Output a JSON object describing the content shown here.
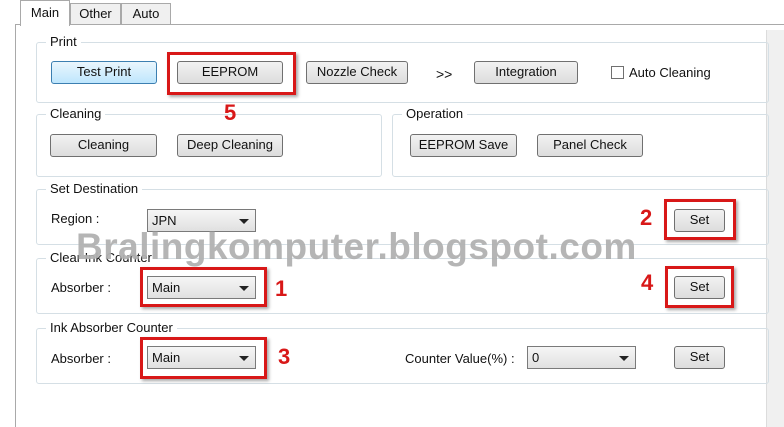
{
  "tabs": [
    {
      "label": "Main",
      "active": true
    },
    {
      "label": "Other",
      "active": false
    },
    {
      "label": "Auto",
      "active": false
    }
  ],
  "print_group": {
    "title": "Print",
    "test_print": "Test Print",
    "eeprom": "EEPROM",
    "nozzle_check": "Nozzle Check",
    "arrows": ">>",
    "integration": "Integration",
    "auto_cleaning": "Auto Cleaning",
    "auto_cleaning_checked": false
  },
  "cleaning_group": {
    "title": "Cleaning",
    "cleaning": "Cleaning",
    "deep_cleaning": "Deep Cleaning"
  },
  "operation_group": {
    "title": "Operation",
    "eeprom_save": "EEPROM Save",
    "panel_check": "Panel Check"
  },
  "destination_group": {
    "title": "Set Destination",
    "region_label": "Region :",
    "region_value": "JPN",
    "set": "Set"
  },
  "clear_counter_group": {
    "title": "Clear Ink Counter",
    "absorber_label": "Absorber :",
    "absorber_value": "Main",
    "set": "Set"
  },
  "ink_absorber_group": {
    "title": "Ink Absorber Counter",
    "absorber_label": "Absorber :",
    "absorber_value": "Main",
    "counter_label": "Counter Value(%) :",
    "counter_value": "0",
    "set": "Set"
  },
  "annotations": {
    "one": "1",
    "two": "2",
    "three": "3",
    "four": "4",
    "five": "5",
    "color": "#d81818"
  },
  "watermark": "Bralingkomputer.blogspot.com"
}
